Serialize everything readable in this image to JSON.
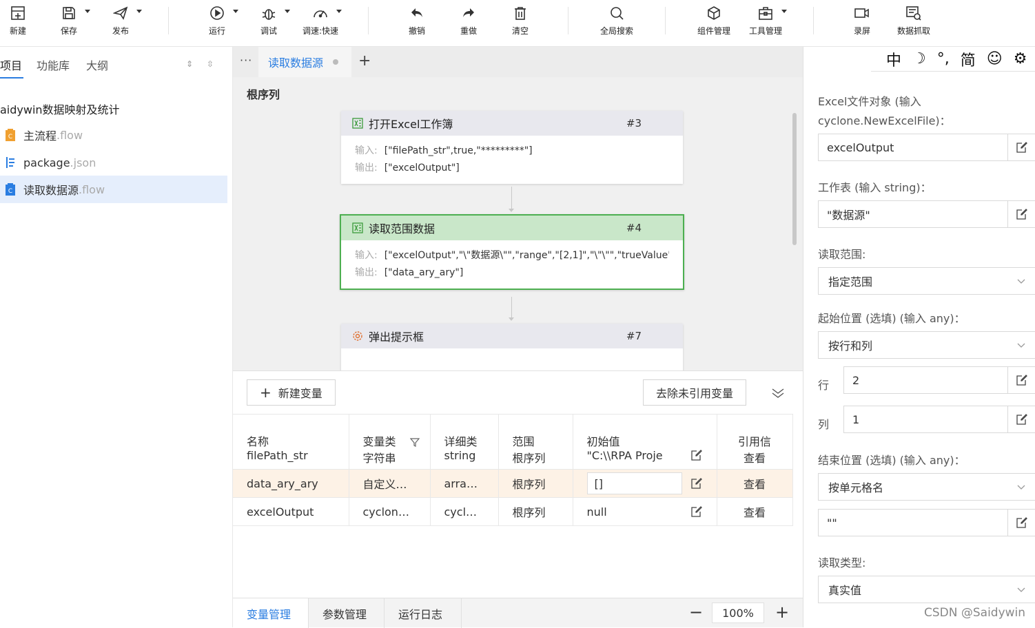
{
  "toolbar": {
    "items": [
      {
        "label": "新建",
        "icon": "new-file-icon"
      },
      {
        "label": "保存",
        "icon": "save-icon"
      },
      {
        "label": "发布",
        "icon": "publish-icon"
      },
      {
        "label": "运行",
        "icon": "run-icon"
      },
      {
        "label": "调试",
        "icon": "debug-icon"
      },
      {
        "label": "调速:快速",
        "icon": "speed-icon"
      },
      {
        "label": "撤销",
        "icon": "undo-icon"
      },
      {
        "label": "重做",
        "icon": "redo-icon"
      },
      {
        "label": "清空",
        "icon": "clear-icon"
      },
      {
        "label": "全局搜索",
        "icon": "search-icon"
      },
      {
        "label": "组件管理",
        "icon": "component-icon"
      },
      {
        "label": "工具管理",
        "icon": "toolbox-icon"
      },
      {
        "label": "录屏",
        "icon": "record-icon"
      },
      {
        "label": "数据抓取",
        "icon": "data-capture-icon"
      }
    ]
  },
  "left": {
    "tabs": [
      "项目",
      "功能库",
      "大纲"
    ],
    "project_title": "aidywin数据映射及统计",
    "files": [
      {
        "name": "主流程",
        "ext": ".flow",
        "icon_color": "#f0a030"
      },
      {
        "name": "package",
        "ext": ".json",
        "icon_color": "#2a7de1"
      },
      {
        "name": "读取数据源",
        "ext": ".flow",
        "icon_color": "#2a7de1"
      }
    ]
  },
  "center": {
    "tab_more": "···",
    "active_tab": "读取数据源",
    "tab_add": "+",
    "canvas_title": "根序列",
    "nodes": [
      {
        "title": "打开Excel工作簿",
        "num": "#3",
        "in_label": "输入:",
        "in": "[\"filePath_str\",true,\"*********\"]",
        "out_label": "输出:",
        "out": "[\"excelOutput\"]"
      },
      {
        "title": "读取范围数据",
        "num": "#4",
        "in_label": "输入:",
        "in": "[\"excelOutput\",\"\\\"数据源\\\"\",\"range\",\"[2,1]\",\"\\\"\\\"\",\"trueValue\",",
        "out_label": "输出:",
        "out": "[\"data_ary_ary\"]"
      },
      {
        "title": "弹出提示框",
        "num": "#7"
      }
    ],
    "vars": {
      "new_btn": "新建变量",
      "remove_btn": "去除未引用变量",
      "headers": [
        "名称",
        "变量类",
        "详细类",
        "范围",
        "初始值",
        "引用信"
      ],
      "rows": [
        {
          "name": "filePath_str",
          "type": "字符串",
          "detail": "string",
          "scope": "根序列",
          "init": "\"C:\\\\RPA Proje",
          "ref": "查看"
        },
        {
          "name": "data_ary_ary",
          "type": "自定义…",
          "detail": "arra…",
          "scope": "根序列",
          "init": "[]",
          "ref": "查看"
        },
        {
          "name": "excelOutput",
          "type": "cyclon…",
          "detail": "cycl…",
          "scope": "根序列",
          "init": "null",
          "ref": "查看"
        }
      ]
    },
    "bottom_tabs": [
      "变量管理",
      "参数管理",
      "运行日志"
    ],
    "zoom": "100%",
    "zoom_minus": "−",
    "zoom_plus": "+"
  },
  "right": {
    "ime": [
      "中",
      "☽",
      "°,",
      "简",
      "☺",
      "⚙"
    ],
    "fields": {
      "excel_label": "Excel文件对象 (输入 cyclone.NewExcelFile)：",
      "excel_value": "excelOutput",
      "sheet_label": "工作表 (输入 string)：",
      "sheet_value": "\"数据源\"",
      "range_label": "读取范围:",
      "range_value": "指定范围",
      "start_label": "起始位置 (选填) (输入 any)：",
      "start_value": "按行和列",
      "row_label": "行",
      "row_value": "2",
      "col_label": "列",
      "col_value": "1",
      "end_label": "结束位置 (选填) (输入 any)：",
      "end_value": "按单元格名",
      "end_cell_value": "\"\"",
      "read_type_label": "读取类型:",
      "read_type_value": "真实值"
    },
    "watermark": "CSDN @Saidywin"
  }
}
